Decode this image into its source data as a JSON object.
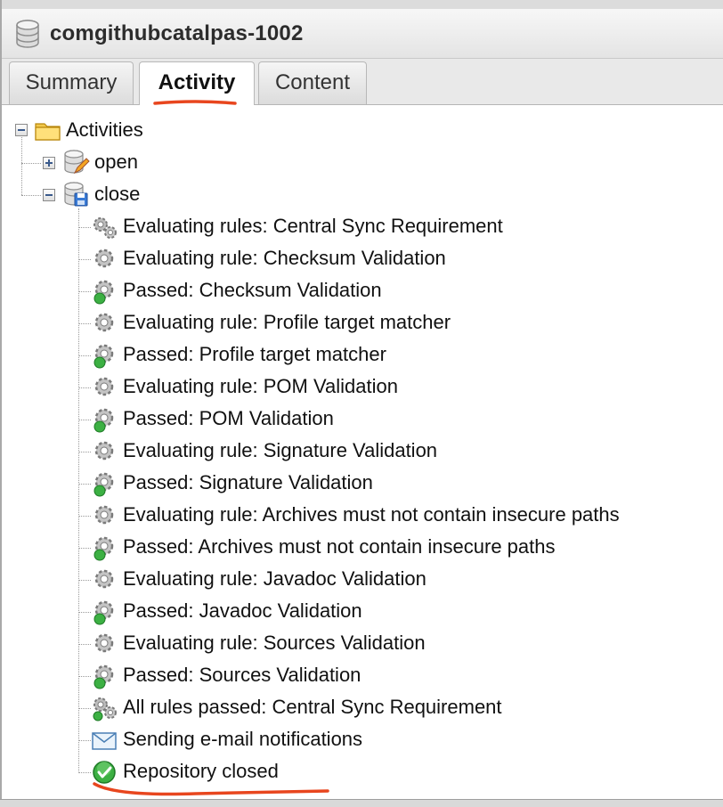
{
  "header": {
    "title": "comgithubcatalpas-1002",
    "icon": "database-icon"
  },
  "tabs": [
    {
      "label": "Summary",
      "active": false
    },
    {
      "label": "Activity",
      "active": true
    },
    {
      "label": "Content",
      "active": false
    }
  ],
  "tree": {
    "root": {
      "label": "Activities",
      "icon": "folder-icon",
      "expanded": true
    },
    "children": [
      {
        "label": "open",
        "icon": "database-edit-icon",
        "expanded": false
      },
      {
        "label": "close",
        "icon": "database-save-icon",
        "expanded": true
      }
    ],
    "close_events": [
      {
        "label": "Evaluating rules: Central Sync Requirement",
        "icon": "gears-icon"
      },
      {
        "label": "Evaluating rule: Checksum Validation",
        "icon": "gear-icon"
      },
      {
        "label": "Passed: Checksum Validation",
        "icon": "gear-passed-icon"
      },
      {
        "label": "Evaluating rule: Profile target matcher",
        "icon": "gear-icon"
      },
      {
        "label": "Passed: Profile target matcher",
        "icon": "gear-passed-icon"
      },
      {
        "label": "Evaluating rule: POM Validation",
        "icon": "gear-icon"
      },
      {
        "label": "Passed: POM Validation",
        "icon": "gear-passed-icon"
      },
      {
        "label": "Evaluating rule: Signature Validation",
        "icon": "gear-icon"
      },
      {
        "label": "Passed: Signature Validation",
        "icon": "gear-passed-icon"
      },
      {
        "label": "Evaluating rule: Archives must not contain insecure paths",
        "icon": "gear-icon"
      },
      {
        "label": "Passed: Archives must not contain insecure paths",
        "icon": "gear-passed-icon"
      },
      {
        "label": "Evaluating rule: Javadoc Validation",
        "icon": "gear-icon"
      },
      {
        "label": "Passed: Javadoc Validation",
        "icon": "gear-passed-icon"
      },
      {
        "label": "Evaluating rule: Sources Validation",
        "icon": "gear-icon"
      },
      {
        "label": "Passed: Sources Validation",
        "icon": "gear-passed-icon"
      },
      {
        "label": "All rules passed: Central Sync Requirement",
        "icon": "gears-passed-icon"
      },
      {
        "label": "Sending e-mail notifications",
        "icon": "email-icon"
      },
      {
        "label": "Repository closed",
        "icon": "check-circle-icon"
      }
    ]
  },
  "colors": {
    "annotation_red": "#e8461e",
    "passed_green": "#3cb043",
    "tab_bg": "#e9e9e9"
  }
}
